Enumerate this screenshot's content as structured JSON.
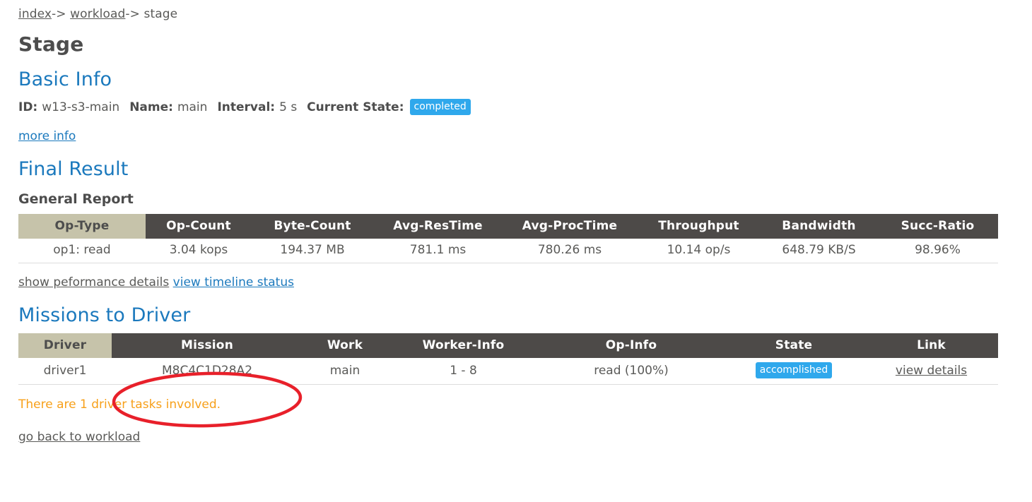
{
  "breadcrumb": {
    "items": [
      {
        "label": "index",
        "link": true
      },
      {
        "label": "workload",
        "link": true
      },
      {
        "label": "stage",
        "link": false
      }
    ],
    "separator": "->"
  },
  "page_title": "Stage",
  "basic_info": {
    "heading": "Basic Info",
    "id_label": "ID:",
    "id_value": "w13-s3-main",
    "name_label": "Name:",
    "name_value": "main",
    "interval_label": "Interval:",
    "interval_value": "5 s",
    "state_label": "Current State:",
    "state_value": "completed",
    "more_info_link": "more info"
  },
  "final_result": {
    "heading": "Final Result",
    "subheading": "General Report",
    "columns": [
      "Op-Type",
      "Op-Count",
      "Byte-Count",
      "Avg-ResTime",
      "Avg-ProcTime",
      "Throughput",
      "Bandwidth",
      "Succ-Ratio"
    ],
    "rows": [
      [
        "op1: read",
        "3.04 kops",
        "194.37 MB",
        "781.1 ms",
        "780.26 ms",
        "10.14 op/s",
        "648.79 KB/S",
        "98.96%"
      ]
    ],
    "links": [
      {
        "label": "show peformance details",
        "style": "dark"
      },
      {
        "label": "view timeline status",
        "style": "blue"
      }
    ]
  },
  "missions": {
    "heading": "Missions to Driver",
    "columns": [
      "Driver",
      "Mission",
      "Work",
      "Worker-Info",
      "Op-Info",
      "State",
      "Link"
    ],
    "rows": [
      {
        "driver": "driver1",
        "mission": "M8C4C1D28A2",
        "work": "main",
        "worker_info": "1 - 8",
        "op_info": "read (100%)",
        "state": "accomplished",
        "link": "view details"
      }
    ],
    "note": "There are 1 driver tasks involved.",
    "back_link": "go back to workload"
  },
  "annotation": {
    "shape": "ellipse",
    "color": "#e8202a",
    "target": "M8C4C1D28A2"
  },
  "colors": {
    "accent_blue": "#1b79bd",
    "badge_blue": "#2fa8ec",
    "header_dark": "#4d4a48",
    "header_tan": "#c6c3aa",
    "warning_orange": "#f7a01a",
    "annotation_red": "#e8202a",
    "text": "#5a5a58"
  }
}
